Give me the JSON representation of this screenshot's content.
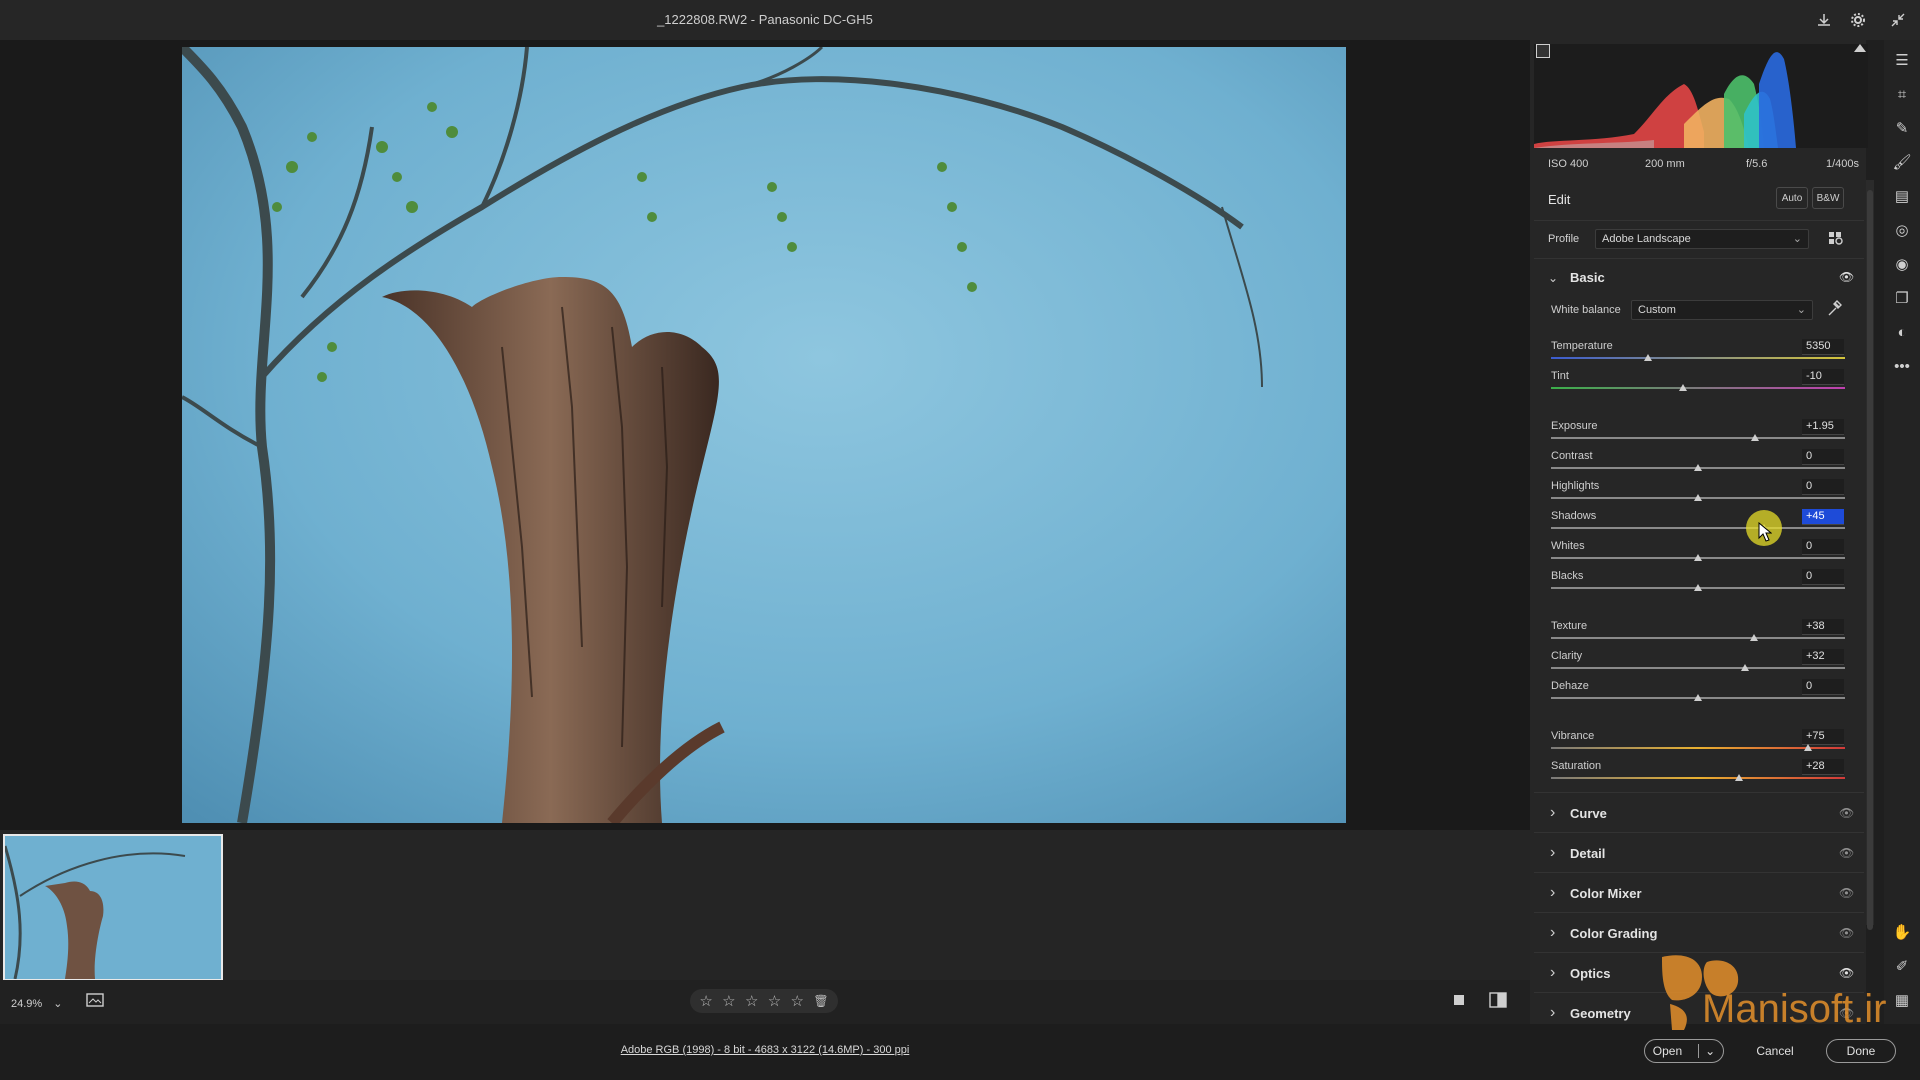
{
  "title": "_1222808.RW2  -  Panasonic DC-GH5",
  "exif": {
    "iso": "ISO 400",
    "focal": "200 mm",
    "aperture": "f/5.6",
    "shutter": "1/400s"
  },
  "edit": {
    "heading": "Edit",
    "auto_label": "Auto",
    "bw_label": "B&W"
  },
  "profile": {
    "label": "Profile",
    "value": "Adobe Landscape"
  },
  "basic": {
    "title": "Basic",
    "white_balance_label": "White balance",
    "white_balance_value": "Custom",
    "sliders": [
      {
        "label": "Temperature",
        "value": "5350",
        "position": 0.33
      },
      {
        "label": "Tint",
        "value": "-10",
        "position": 0.45
      },
      {
        "label": "Exposure",
        "value": "+1.95",
        "position": 0.695
      },
      {
        "label": "Contrast",
        "value": "0",
        "position": 0.5
      },
      {
        "label": "Highlights",
        "value": "0",
        "position": 0.5
      },
      {
        "label": "Shadows",
        "value": "+45",
        "position": 0.725
      },
      {
        "label": "Whites",
        "value": "0",
        "position": 0.5
      },
      {
        "label": "Blacks",
        "value": "0",
        "position": 0.5
      },
      {
        "label": "Texture",
        "value": "+38",
        "position": 0.69
      },
      {
        "label": "Clarity",
        "value": "+32",
        "position": 0.66
      },
      {
        "label": "Dehaze",
        "value": "0",
        "position": 0.5
      },
      {
        "label": "Vibrance",
        "value": "+75",
        "position": 0.875
      },
      {
        "label": "Saturation",
        "value": "+28",
        "position": 0.64
      }
    ]
  },
  "sections": [
    "Curve",
    "Detail",
    "Color Mixer",
    "Color Grading",
    "Optics",
    "Geometry"
  ],
  "zoom": "24.9%",
  "file_info": "Adobe RGB (1998) - 8 bit - 4683 x 3122 (14.6MP) - 300 ppi",
  "buttons": {
    "open": "Open",
    "cancel": "Cancel",
    "done": "Done"
  },
  "watermark": "Manisoft.ir",
  "colors": {
    "accent": "#1e4bd8",
    "sky": "#7ab6d4",
    "watermark": "#d98a2b"
  },
  "icons": [
    "download-icon",
    "settings-gear-icon",
    "collapse-icon",
    "edit-sliders-icon",
    "crop-icon",
    "healing-icon",
    "brush-icon",
    "linear-gradient-icon",
    "radial-gradient-icon",
    "redeye-icon",
    "snapshots-icon",
    "presets-icon",
    "more-icon",
    "hand-icon",
    "sampler-icon",
    "grid-icon",
    "star-icon",
    "trash-icon",
    "compare-icon",
    "filmstrip-icon",
    "eye-icon",
    "eyedropper-icon",
    "profile-browser-icon"
  ]
}
